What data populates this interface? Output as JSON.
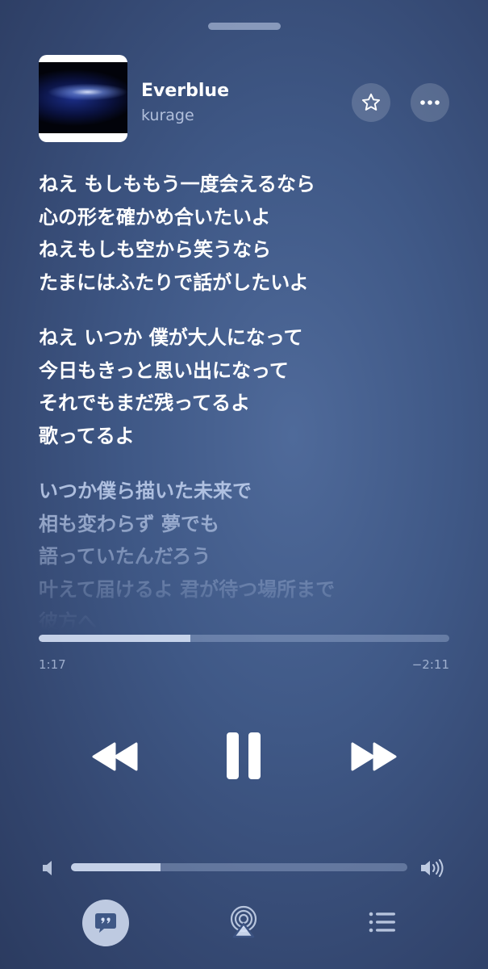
{
  "now_playing": {
    "title": "Everblue",
    "artist": "kurage"
  },
  "icons": {
    "grabber": "sheet-grabber",
    "favorite": "star-icon",
    "more": "ellipsis-icon",
    "rewind": "rewind-icon",
    "pause": "pause-icon",
    "forward": "fast-forward-icon",
    "volume_low": "speaker-low-icon",
    "volume_high": "speaker-high-icon",
    "lyrics": "lyrics-quote-bubble-icon",
    "airplay": "airplay-icon",
    "queue": "queue-list-icon"
  },
  "lyrics": {
    "stanza1": [
      "ねえ もしももう一度会えるなら",
      "心の形を確かめ合いたいよ",
      "ねえもしも空から笑うなら",
      "たまにはふたりで話がしたいよ"
    ],
    "stanza2": [
      "ねえ いつか 僕が大人になって",
      "今日もきっと思い出になって",
      "それでもまだ残ってるよ",
      "歌ってるよ"
    ],
    "stanza3": [
      "いつか僕ら描いた未来で",
      "相も変わらず 夢でも",
      "語っていたんだろう",
      "叶えて届けるよ 君が待つ場所まで",
      "彼方へ"
    ]
  },
  "playback": {
    "elapsed": "1:17",
    "remaining": "−2:11",
    "progress_fraction": 0.37
  },
  "volume": {
    "level_fraction": 0.265
  },
  "colors": {
    "background": "#3f5886",
    "accent_fill": "#d7e2f6",
    "track": "#7f92b8"
  }
}
